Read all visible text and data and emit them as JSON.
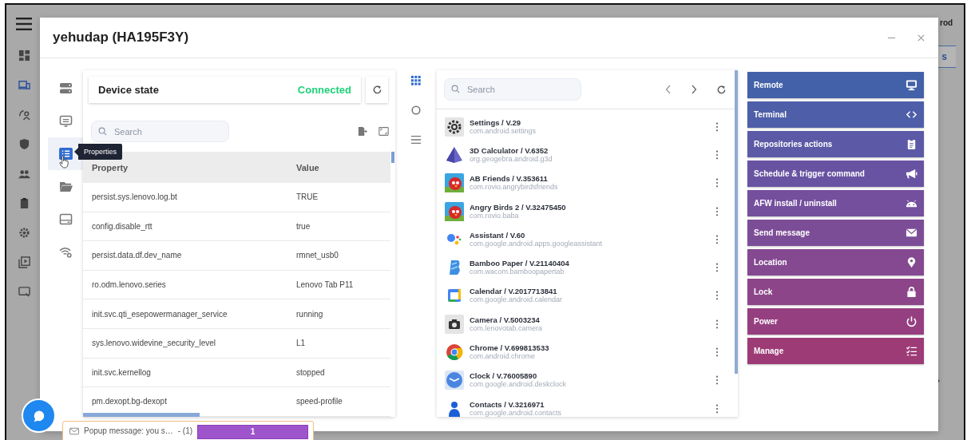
{
  "background": {
    "user_text": "rod",
    "button_text": "s"
  },
  "window": {
    "title": "yehudap (HA195F3Y)"
  },
  "side_tools": [
    {
      "kind": "server",
      "selected": false
    },
    {
      "kind": "monitor",
      "selected": false
    },
    {
      "kind": "list",
      "selected": true
    },
    {
      "kind": "folder",
      "selected": false
    },
    {
      "kind": "drive",
      "selected": false
    },
    {
      "kind": "wifi",
      "selected": false
    }
  ],
  "tooltip": "Properties",
  "device_state": {
    "label": "Device state",
    "status": "Connected"
  },
  "properties": {
    "search": {
      "placeholder": "Search"
    },
    "columns": [
      "Property",
      "Value"
    ],
    "rows": [
      {
        "property": "persist.sys.lenovo.log.bt",
        "value": "TRUE"
      },
      {
        "property": "config.disable_rtt",
        "value": "true"
      },
      {
        "property": "persist.data.df.dev_name",
        "value": "rmnet_usb0"
      },
      {
        "property": "ro.odm.lenovo.series",
        "value": "Lenovo Tab P11"
      },
      {
        "property": "init.svc.qti_esepowermanager_service",
        "value": "running"
      },
      {
        "property": "sys.lenovo.widevine_security_level",
        "value": "L1"
      },
      {
        "property": "init.svc.kernellog",
        "value": "stopped"
      },
      {
        "property": "pm.dexopt.bg-dexopt",
        "value": "speed-profile"
      }
    ]
  },
  "app_tools": [
    {
      "kind": "grid",
      "selected": true
    },
    {
      "kind": "circle",
      "selected": false
    },
    {
      "kind": "list",
      "selected": false
    }
  ],
  "apps": {
    "search": {
      "placeholder": "Search"
    },
    "items": [
      {
        "kind": "gear",
        "name": "Settings / V.29",
        "package": "com.android.settings"
      },
      {
        "kind": "pyramid",
        "name": "3D Calculator / V.6352",
        "package": "org.geogebra.android.g3d"
      },
      {
        "kind": "bird",
        "name": "AB Friends / V.353611",
        "package": "com.rovio.angrybirdsfriends"
      },
      {
        "kind": "bird",
        "name": "Angry Birds 2 / V.32475450",
        "package": "com.rovio.baba"
      },
      {
        "kind": "assistant",
        "name": "Assistant / V.60",
        "package": "com.google.android.apps.googleassistant"
      },
      {
        "kind": "pen",
        "name": "Bamboo Paper / V.21140404",
        "package": "com.wacom.bamboopapertab"
      },
      {
        "kind": "calendar",
        "name": "Calendar / V.2017713841",
        "package": "com.google.android.calendar"
      },
      {
        "kind": "camera",
        "name": "Camera / V.5003234",
        "package": "com.lenovotab.camera"
      },
      {
        "kind": "chrome",
        "name": "Chrome / V.699813533",
        "package": "com.android.chrome"
      },
      {
        "kind": "clock",
        "name": "Clock / V.76005890",
        "package": "com.google.android.deskclock"
      },
      {
        "kind": "person",
        "name": "Contacts / V.3216971",
        "package": "com.google.android.contacts"
      }
    ]
  },
  "actions": [
    {
      "kind": "monitor",
      "label": "Remote",
      "color": "#4361a8"
    },
    {
      "kind": "code",
      "label": "Terminal",
      "color": "#4e5ea8"
    },
    {
      "kind": "clipboard",
      "label": "Repositories actions",
      "color": "#5c59a6"
    },
    {
      "kind": "megaphone",
      "label": "Schedule & trigger command",
      "color": "#6853a2"
    },
    {
      "kind": "android",
      "label": "AFW install / uninstall",
      "color": "#744f9d"
    },
    {
      "kind": "envelope",
      "label": "Send message",
      "color": "#7c4d97"
    },
    {
      "kind": "pin",
      "label": "Location",
      "color": "#844990"
    },
    {
      "kind": "lock",
      "label": "Lock",
      "color": "#8d4589"
    },
    {
      "kind": "power",
      "label": "Power",
      "color": "#963f80"
    },
    {
      "kind": "checklist",
      "label": "Manage",
      "color": "#9d3b76"
    }
  ],
  "popup": {
    "message": "Popup message: you s…",
    "count": "- (1)",
    "badge": "1"
  }
}
